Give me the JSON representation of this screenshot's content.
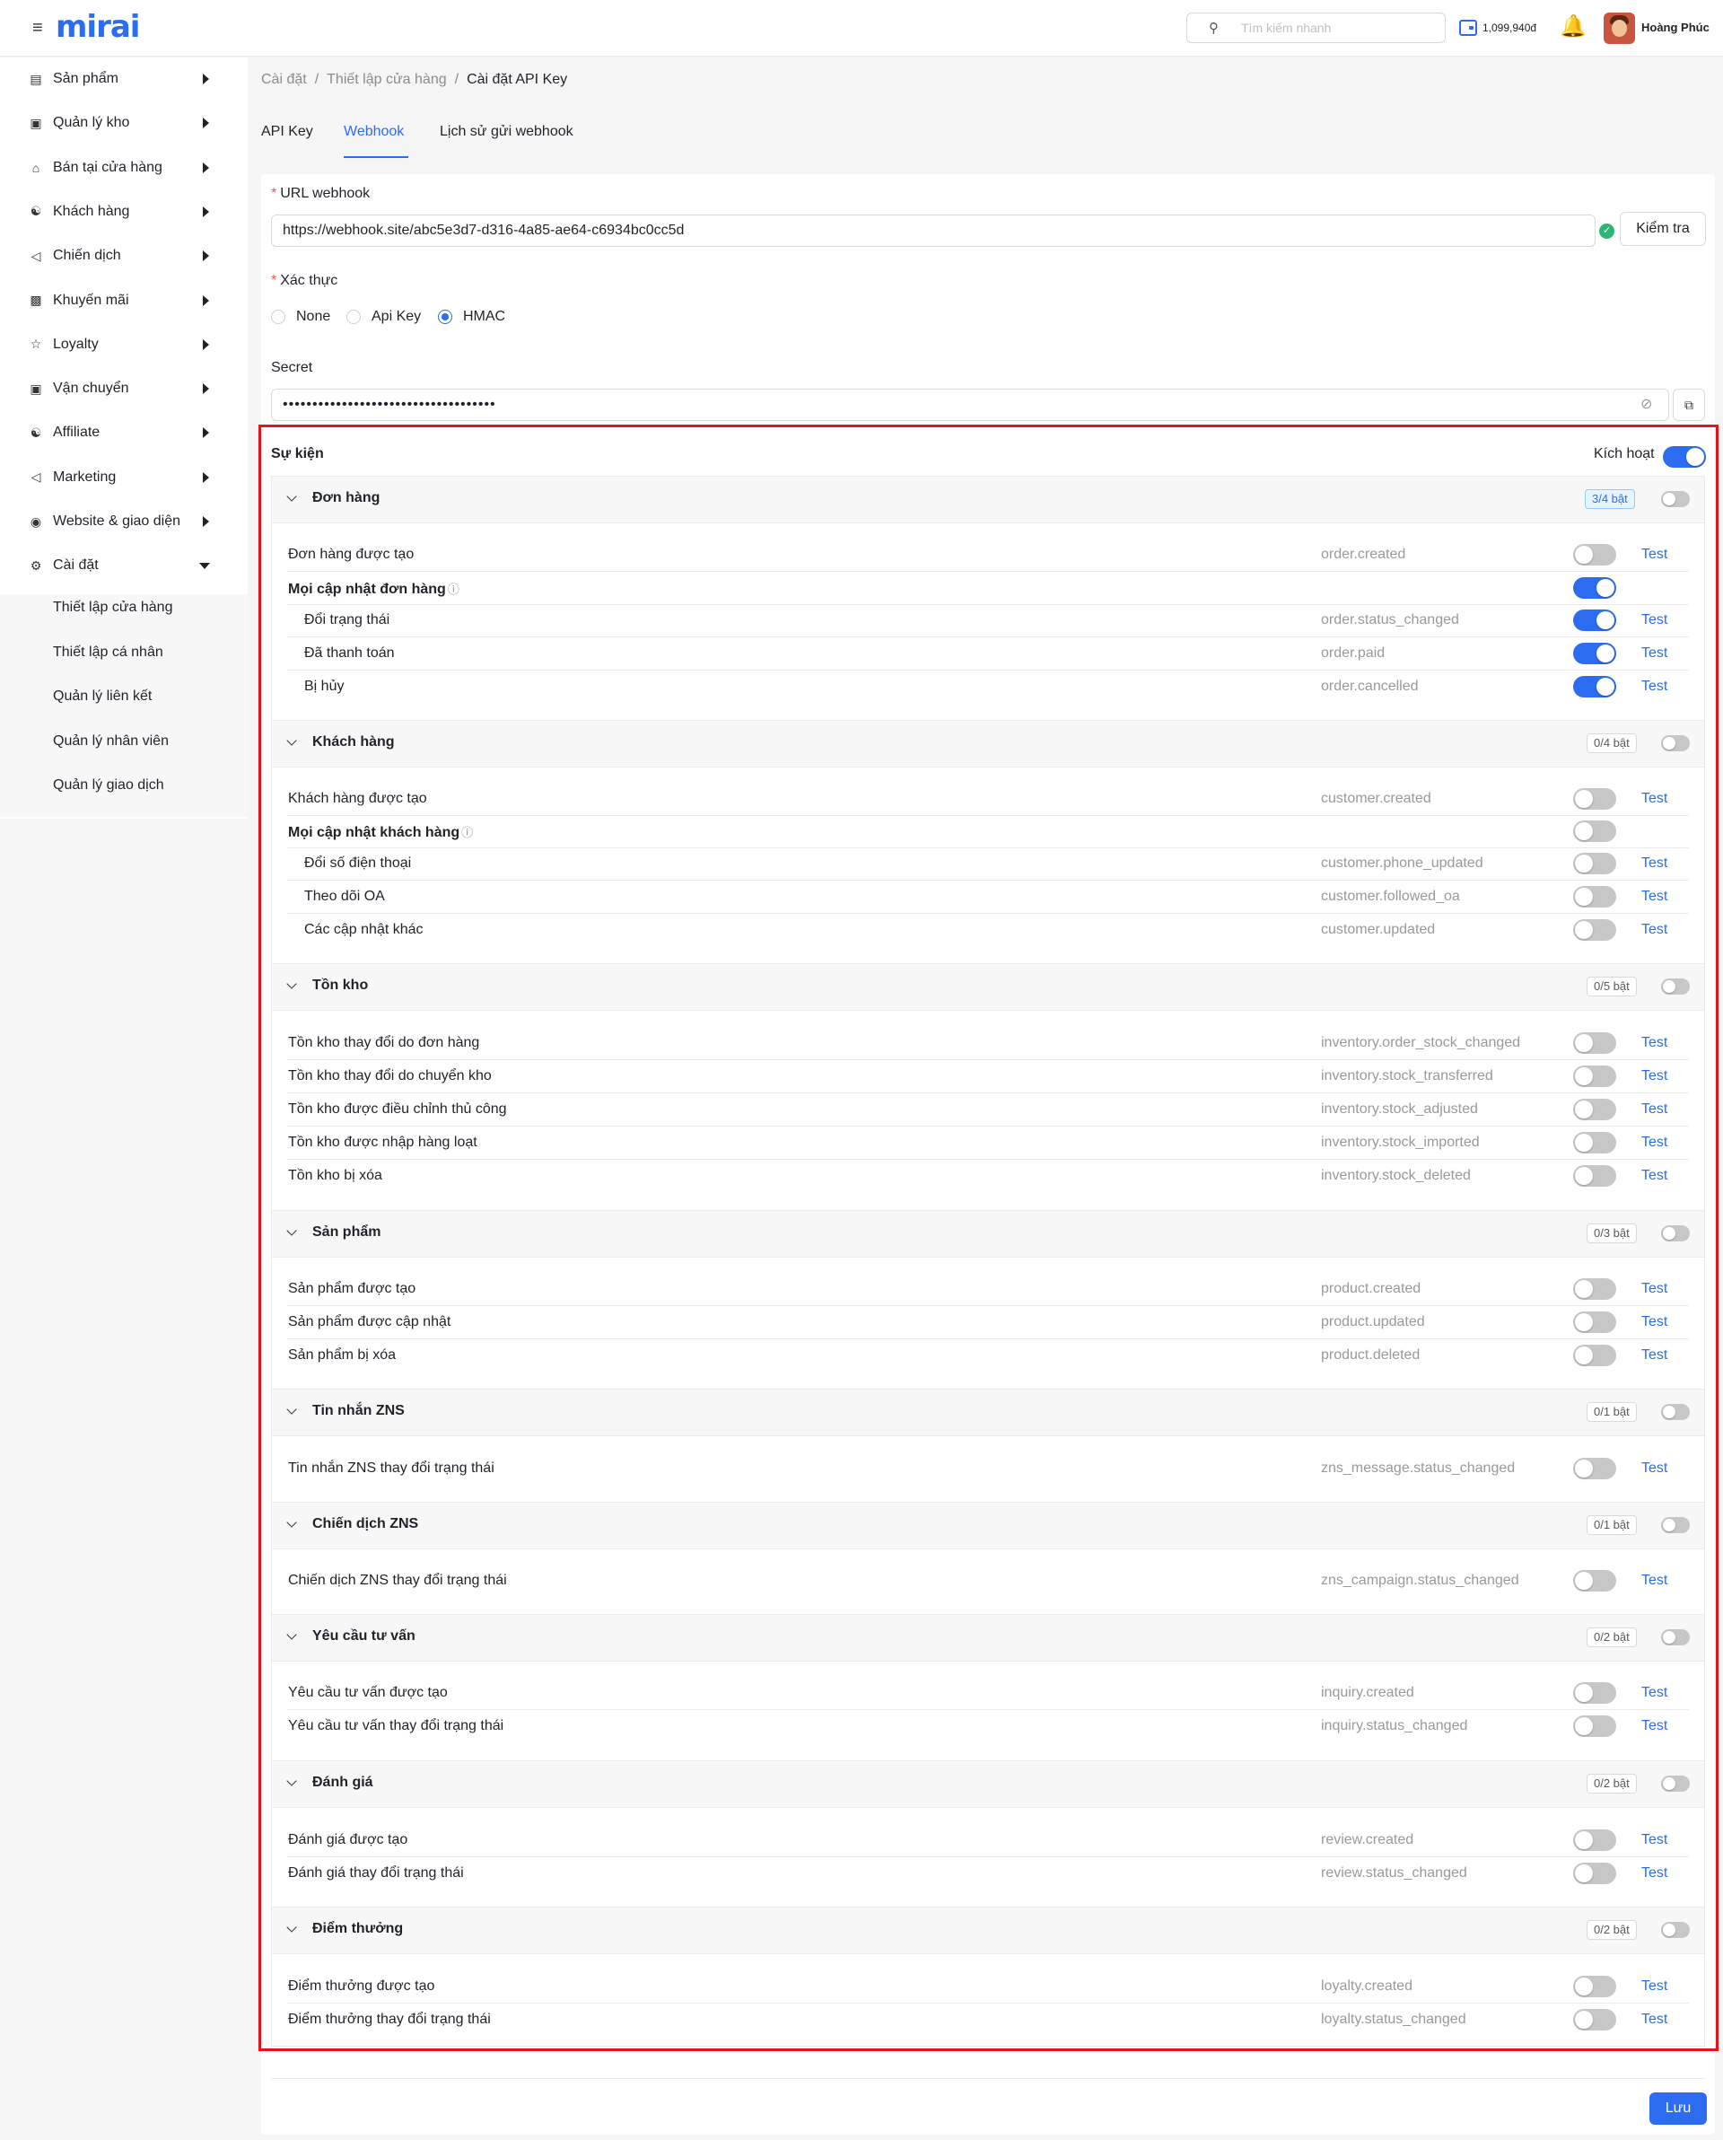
{
  "header": {
    "logo": "mirai",
    "search_placeholder": "Tìm kiếm nhanh",
    "balance": "1,099,940đ",
    "user_name": "Hoàng Phúc"
  },
  "sidebar": {
    "items": [
      {
        "label": "Sản phẩm",
        "icon": "document-icon",
        "expanded": false
      },
      {
        "label": "Quản lý kho",
        "icon": "archive-icon",
        "expanded": false
      },
      {
        "label": "Bán tại cửa hàng",
        "icon": "store-icon",
        "expanded": false
      },
      {
        "label": "Khách hàng",
        "icon": "users-icon",
        "expanded": false
      },
      {
        "label": "Chiến dịch",
        "icon": "megaphone-icon",
        "expanded": false
      },
      {
        "label": "Khuyến mãi",
        "icon": "gift-icon",
        "expanded": false
      },
      {
        "label": "Loyalty",
        "icon": "star-icon",
        "expanded": false
      },
      {
        "label": "Vận chuyển",
        "icon": "truck-icon",
        "expanded": false
      },
      {
        "label": "Affiliate",
        "icon": "affiliate-icon",
        "expanded": false
      },
      {
        "label": "Marketing",
        "icon": "bullhorn-icon",
        "expanded": false
      },
      {
        "label": "Website & giao diện",
        "icon": "globe-icon",
        "expanded": false
      },
      {
        "label": "Cài đặt",
        "icon": "gear-icon",
        "expanded": true
      }
    ],
    "sub_items": [
      "Thiết lập cửa hàng",
      "Thiết lập cá nhân",
      "Quản lý liên kết",
      "Quản lý nhân viên",
      "Quản lý giao dịch"
    ]
  },
  "breadcrumb": [
    "Cài đặt",
    "Thiết lập cửa hàng",
    "Cài đặt API Key"
  ],
  "tabs": [
    {
      "label": "API Key",
      "active": false
    },
    {
      "label": "Webhook",
      "active": true
    },
    {
      "label": "Lịch sử gửi webhook",
      "active": false
    }
  ],
  "form": {
    "url_label": "URL webhook",
    "url_value": "https://webhook.site/abc5e3d7-d316-4a85-ae64-c6934bc0cc5d",
    "check_button": "Kiểm tra",
    "auth_label": "Xác thực",
    "auth_options": [
      {
        "label": "None",
        "selected": false
      },
      {
        "label": "Api Key",
        "selected": false
      },
      {
        "label": "HMAC",
        "selected": true
      }
    ],
    "secret_label": "Secret",
    "secret_value": "••••••••••••••••••••••••••••••••••••"
  },
  "events": {
    "title": "Sự kiện",
    "active_label": "Kích hoạt",
    "active": true,
    "test_label": "Test",
    "groups": [
      {
        "title": "Đơn hàng",
        "badge": "3/4 bật",
        "enabled": false,
        "rows": [
          {
            "name": "Đơn hàng được tạo",
            "code": "order.created",
            "on": false,
            "test": true
          },
          {
            "name": "Mọi cập nhật đơn hàng",
            "code": "",
            "on": true,
            "test": false,
            "bold": true
          },
          {
            "name": "Đổi trạng thái",
            "code": "order.status_changed",
            "on": true,
            "test": true,
            "indent": true
          },
          {
            "name": "Đã thanh toán",
            "code": "order.paid",
            "on": true,
            "test": true,
            "indent": true
          },
          {
            "name": "Bị hủy",
            "code": "order.cancelled",
            "on": true,
            "test": true,
            "indent": true
          }
        ]
      },
      {
        "title": "Khách hàng",
        "badge": "0/4 bật",
        "enabled": false,
        "rows": [
          {
            "name": "Khách hàng được tạo",
            "code": "customer.created",
            "on": false,
            "test": true
          },
          {
            "name": "Mọi cập nhật khách hàng",
            "code": "",
            "on": false,
            "test": false,
            "bold": true
          },
          {
            "name": "Đổi số điện thoại",
            "code": "customer.phone_updated",
            "on": false,
            "test": true,
            "indent": true
          },
          {
            "name": "Theo dõi OA",
            "code": "customer.followed_oa",
            "on": false,
            "test": true,
            "indent": true
          },
          {
            "name": "Các cập nhật khác",
            "code": "customer.updated",
            "on": false,
            "test": true,
            "indent": true
          }
        ]
      },
      {
        "title": "Tồn kho",
        "badge": "0/5 bật",
        "enabled": false,
        "rows": [
          {
            "name": "Tồn kho thay đổi do đơn hàng",
            "code": "inventory.order_stock_changed",
            "on": false,
            "test": true
          },
          {
            "name": "Tồn kho thay đổi do chuyển kho",
            "code": "inventory.stock_transferred",
            "on": false,
            "test": true
          },
          {
            "name": "Tồn kho được điều chỉnh thủ công",
            "code": "inventory.stock_adjusted",
            "on": false,
            "test": true
          },
          {
            "name": "Tồn kho được nhập hàng loạt",
            "code": "inventory.stock_imported",
            "on": false,
            "test": true
          },
          {
            "name": "Tồn kho bị xóa",
            "code": "inventory.stock_deleted",
            "on": false,
            "test": true
          }
        ]
      },
      {
        "title": "Sản phẩm",
        "badge": "0/3 bật",
        "enabled": false,
        "rows": [
          {
            "name": "Sản phẩm được tạo",
            "code": "product.created",
            "on": false,
            "test": true
          },
          {
            "name": "Sản phẩm được cập nhật",
            "code": "product.updated",
            "on": false,
            "test": true
          },
          {
            "name": "Sản phẩm bị xóa",
            "code": "product.deleted",
            "on": false,
            "test": true
          }
        ]
      },
      {
        "title": "Tin nhắn ZNS",
        "badge": "0/1 bật",
        "enabled": false,
        "rows": [
          {
            "name": "Tin nhắn ZNS thay đổi trạng thái",
            "code": "zns_message.status_changed",
            "on": false,
            "test": true
          }
        ]
      },
      {
        "title": "Chiến dịch ZNS",
        "badge": "0/1 bật",
        "enabled": false,
        "rows": [
          {
            "name": "Chiến dịch ZNS thay đổi trạng thái",
            "code": "zns_campaign.status_changed",
            "on": false,
            "test": true
          }
        ]
      },
      {
        "title": "Yêu cầu tư vấn",
        "badge": "0/2 bật",
        "enabled": false,
        "rows": [
          {
            "name": "Yêu cầu tư vấn được tạo",
            "code": "inquiry.created",
            "on": false,
            "test": true
          },
          {
            "name": "Yêu cầu tư vấn thay đổi trạng thái",
            "code": "inquiry.status_changed",
            "on": false,
            "test": true
          }
        ]
      },
      {
        "title": "Đánh giá",
        "badge": "0/2 bật",
        "enabled": false,
        "rows": [
          {
            "name": "Đánh giá được tạo",
            "code": "review.created",
            "on": false,
            "test": true
          },
          {
            "name": "Đánh giá thay đổi trạng thái",
            "code": "review.status_changed",
            "on": false,
            "test": true
          }
        ]
      },
      {
        "title": "Điểm thưởng",
        "badge": "0/2 bật",
        "enabled": false,
        "rows": [
          {
            "name": "Điểm thưởng được tạo",
            "code": "loyalty.created",
            "on": false,
            "test": true
          },
          {
            "name": "Điểm thưởng thay đổi trạng thái",
            "code": "loyalty.status_changed",
            "on": false,
            "test": true
          }
        ]
      }
    ]
  },
  "save_button": "Lưu",
  "colors": {
    "accent": "#2b6cf0",
    "highlight_border": "#e0161b",
    "success": "#2bb673"
  }
}
